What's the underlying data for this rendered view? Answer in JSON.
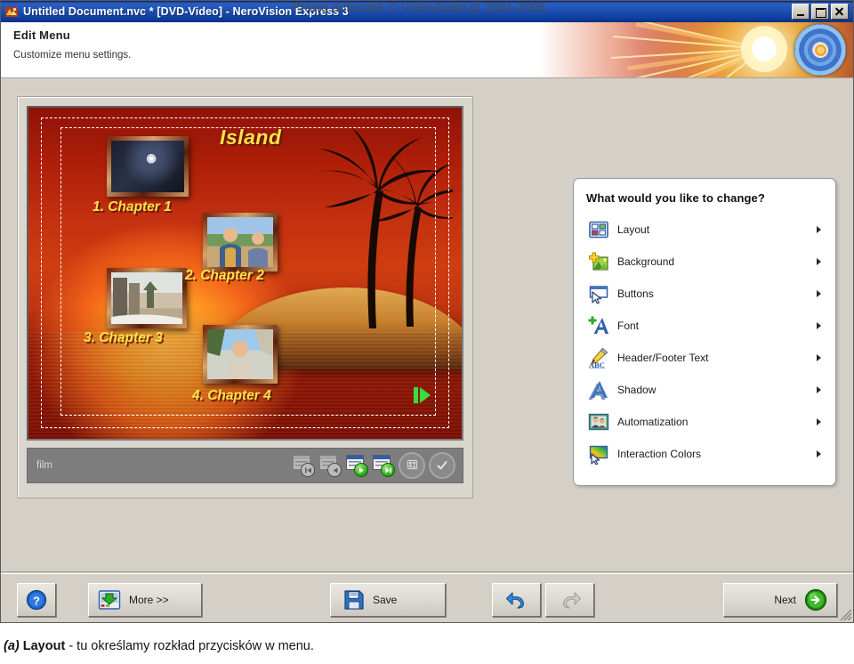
{
  "window": {
    "title": "Untitled Document.nvc * [DVD-Video] - NeroVision Express 3",
    "icon": "nero-app-icon",
    "controls": {
      "minimize": "minimize-icon",
      "maximize": "maximize-icon",
      "close": "close-icon"
    }
  },
  "header": {
    "title": "Edit Menu",
    "subtitle": "Customize menu settings.",
    "art": "dvd-disc-starburst-banner"
  },
  "watermark": "Prawa autorskie © VideoAudio.pl 2001-2008",
  "preview": {
    "menu_title": "Island",
    "chapters": [
      {
        "label": "1. Chapter 1",
        "thumb": "lens-flare-dark-thumbnail"
      },
      {
        "label": "2. Chapter 2",
        "thumb": "two-people-outdoors-thumbnail"
      },
      {
        "label": "3. Chapter 3",
        "thumb": "snowy-street-thumbnail"
      },
      {
        "label": "4. Chapter 4",
        "thumb": "man-under-tree-thumbnail"
      }
    ],
    "next_page_arrow": "green-next-arrow-icon",
    "footer": {
      "label": "film",
      "tools": [
        {
          "name": "first-page-button",
          "icon": "page-first-icon",
          "enabled": false
        },
        {
          "name": "previous-page-button",
          "icon": "page-previous-icon",
          "enabled": false
        },
        {
          "name": "next-page-button",
          "icon": "page-next-icon",
          "enabled": true
        },
        {
          "name": "last-page-button",
          "icon": "page-last-icon",
          "enabled": true
        },
        {
          "name": "remote-control-button",
          "icon": "remote-control-icon",
          "enabled": true
        },
        {
          "name": "confirm-button",
          "icon": "checkmark-circle-icon",
          "enabled": true
        }
      ]
    }
  },
  "task_panel": {
    "heading": "What would you like to change?",
    "items": [
      {
        "label": "Layout",
        "icon": "layout-grid-icon"
      },
      {
        "label": "Background",
        "icon": "background-image-plus-icon"
      },
      {
        "label": "Buttons",
        "icon": "button-cursor-icon"
      },
      {
        "label": "Font",
        "icon": "font-a-plus-icon"
      },
      {
        "label": "Header/Footer Text",
        "icon": "pencil-abc-icon"
      },
      {
        "label": "Shadow",
        "icon": "shadow-a-icon"
      },
      {
        "label": "Automatization",
        "icon": "people-photo-icon"
      },
      {
        "label": "Interaction Colors",
        "icon": "color-gradient-cursor-icon"
      }
    ],
    "arrow_icon": "chevron-right-icon"
  },
  "buttons": {
    "help": {
      "label": "",
      "icon": "help-question-icon"
    },
    "more": {
      "label": "More >>",
      "icon": "more-options-icon"
    },
    "save": {
      "label": "Save",
      "icon": "floppy-disk-icon"
    },
    "undo": {
      "label": "",
      "icon": "undo-arrow-icon",
      "enabled": true
    },
    "redo": {
      "label": "",
      "icon": "redo-arrow-icon",
      "enabled": false
    },
    "next": {
      "label": "Next",
      "icon": "next-green-arrow-icon"
    }
  },
  "caption": {
    "prefix": "(a)",
    "bold": "Layout",
    "rest": " - tu określamy rozkład przycisków w menu."
  },
  "colors": {
    "titlebar_blue": "#0a246a",
    "window_face": "#d4d0c8",
    "accent_yellow": "#ffe14a",
    "accent_green": "#2aa516",
    "link_blue": "#2f5fa8"
  }
}
